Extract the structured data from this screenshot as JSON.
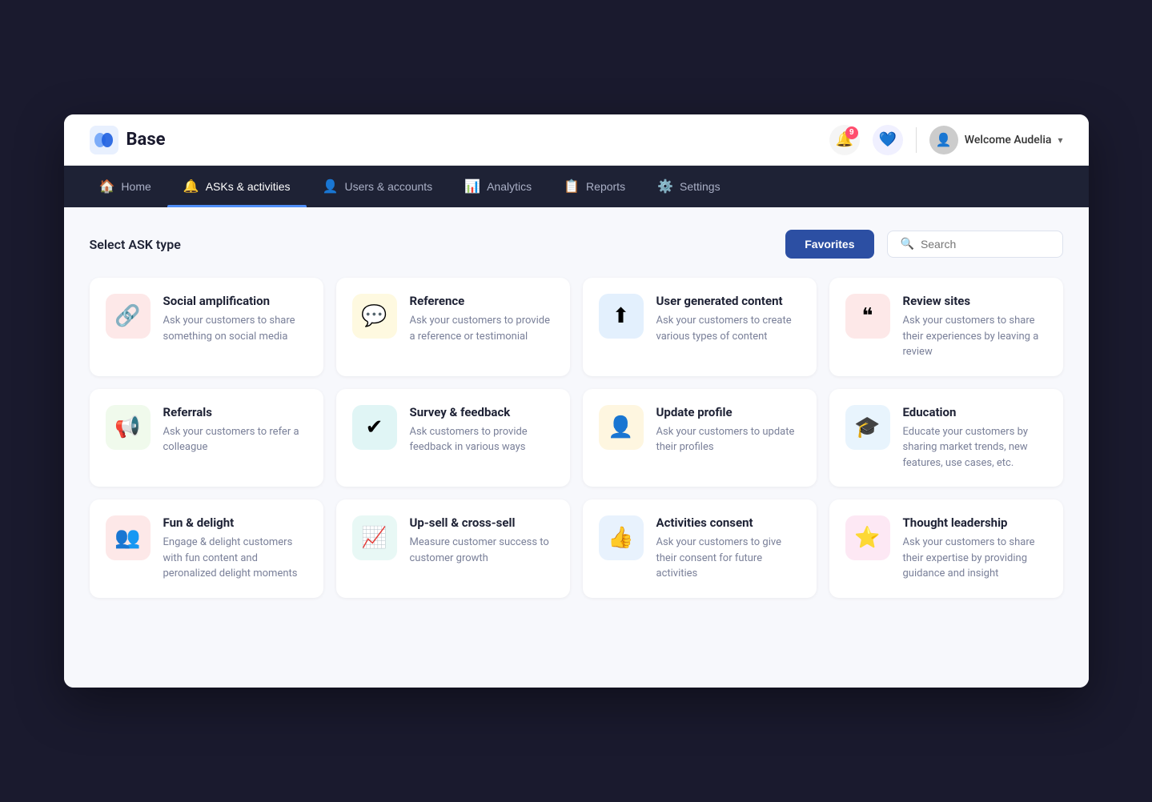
{
  "app": {
    "name": "Base",
    "logo_alt": "Base logo"
  },
  "header": {
    "notification_count": "9",
    "welcome_text": "Welcome Audelia",
    "chevron": "▾"
  },
  "nav": {
    "items": [
      {
        "id": "home",
        "label": "Home",
        "icon": "🏠",
        "active": false
      },
      {
        "id": "asks",
        "label": "ASKs & activities",
        "icon": "🔔",
        "active": true
      },
      {
        "id": "users",
        "label": "Users & accounts",
        "icon": "👤",
        "active": false
      },
      {
        "id": "analytics",
        "label": "Analytics",
        "icon": "📊",
        "active": false
      },
      {
        "id": "reports",
        "label": "Reports",
        "icon": "📋",
        "active": false
      },
      {
        "id": "settings",
        "label": "Settings",
        "icon": "⚙️",
        "active": false
      }
    ]
  },
  "page": {
    "title": "Select ASK type",
    "favorites_label": "Favorites",
    "search_placeholder": "Search"
  },
  "cards": [
    {
      "id": "social-amplification",
      "title": "Social amplification",
      "desc": "Ask your customers to share something on social media",
      "icon": "🔗",
      "icon_bg": "bg-pink"
    },
    {
      "id": "reference",
      "title": "Reference",
      "desc": "Ask your customers to provide a reference or testimonial",
      "icon": "💬",
      "icon_bg": "bg-yellow"
    },
    {
      "id": "user-generated-content",
      "title": "User generated content",
      "desc": "Ask your customers to create various types of content",
      "icon": "⬆",
      "icon_bg": "bg-blue-light"
    },
    {
      "id": "review-sites",
      "title": "Review sites",
      "desc": "Ask your customers to share their experiences by leaving a review",
      "icon": "❝",
      "icon_bg": "bg-salmon"
    },
    {
      "id": "referrals",
      "title": "Referrals",
      "desc": "Ask your customers to refer a colleague",
      "icon": "📢",
      "icon_bg": "bg-yellow2"
    },
    {
      "id": "survey-feedback",
      "title": "Survey & feedback",
      "desc": "Ask customers to provide feedback in various ways",
      "icon": "✔",
      "icon_bg": "bg-teal"
    },
    {
      "id": "update-profile",
      "title": "Update profile",
      "desc": "Ask your customers to update their profiles",
      "icon": "👤",
      "icon_bg": "bg-yellow3"
    },
    {
      "id": "education",
      "title": "Education",
      "desc": "Educate your customers by sharing market trends, new features, use cases, etc.",
      "icon": "🎓",
      "icon_bg": "bg-blue2"
    },
    {
      "id": "fun-delight",
      "title": "Fun & delight",
      "desc": "Engage & delight customers with fun content and peronalized delight moments",
      "icon": "👥",
      "icon_bg": "bg-pink2"
    },
    {
      "id": "upsell-crosssell",
      "title": "Up-sell & cross-sell",
      "desc": "Measure customer success to customer growth",
      "icon": "📈",
      "icon_bg": "bg-teal2"
    },
    {
      "id": "activities-consent",
      "title": "Activities consent",
      "desc": "Ask your customers to give their consent for future activities",
      "icon": "👍",
      "icon_bg": "bg-blue3"
    },
    {
      "id": "thought-leadership",
      "title": "Thought leadership",
      "desc": "Ask your customers to share their expertise by providing guidance and insight",
      "icon": "⭐",
      "icon_bg": "bg-pink3"
    }
  ]
}
